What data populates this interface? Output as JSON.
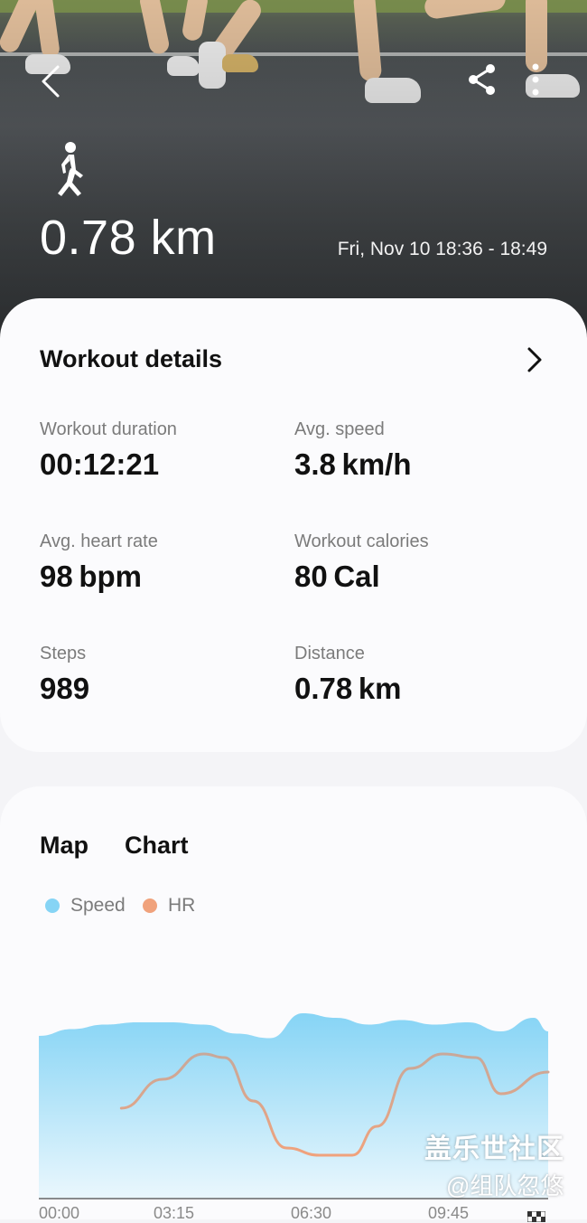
{
  "hero": {
    "distance": "0.78 km",
    "date_range": "Fri, Nov 10 18:36 - 18:49"
  },
  "icons": {
    "back": "back-arrow-icon",
    "share": "share-icon",
    "more": "more-vertical-icon",
    "activity": "walking-person-icon",
    "details": "chevron-right-icon"
  },
  "workout_details": {
    "title": "Workout details",
    "stats": [
      {
        "label": "Workout duration",
        "value": "00:12:21"
      },
      {
        "label": "Avg. speed",
        "value": "3.8 km/h"
      },
      {
        "label": "Avg. heart rate",
        "value": "98 bpm"
      },
      {
        "label": "Workout calories",
        "value": "80 Cal"
      },
      {
        "label": "Steps",
        "value": "989"
      },
      {
        "label": "Distance",
        "value": "0.78 km"
      }
    ]
  },
  "map_chart": {
    "tabs": [
      "Map",
      "Chart"
    ],
    "legend": [
      {
        "name": "Speed",
        "color": "#86d4f5"
      },
      {
        "name": "HR",
        "color": "#f0a27c"
      }
    ]
  },
  "chart_data": {
    "type": "area",
    "x_ticks": [
      "00:00",
      "03:15",
      "06:30",
      "09:45"
    ],
    "series": [
      {
        "name": "Speed",
        "kind": "area",
        "color": "#86d4f5",
        "x": [
          0,
          0.8,
          1.6,
          2.4,
          3.2,
          4.0,
          4.8,
          5.6,
          6.4,
          7.2,
          8.0,
          8.8,
          9.6,
          10.4,
          11.2,
          12.0,
          12.35
        ],
        "values": [
          3.6,
          3.75,
          3.85,
          3.9,
          3.9,
          3.85,
          3.65,
          3.55,
          4.1,
          4.0,
          3.85,
          3.95,
          3.85,
          3.9,
          3.7,
          4.0,
          3.7
        ]
      },
      {
        "name": "HR",
        "kind": "line",
        "color": "#f0a27c",
        "x": [
          2.0,
          3.0,
          4.0,
          4.5,
          5.2,
          6.0,
          6.8,
          7.6,
          8.2,
          9.0,
          9.8,
          10.6,
          11.2,
          12.35
        ],
        "values": [
          95,
          103,
          110,
          109,
          97,
          84,
          82,
          82,
          90,
          106,
          110,
          109,
          99,
          105
        ]
      }
    ]
  },
  "watermark": {
    "line1": "盖乐世社区",
    "line2": "@组队忽悠"
  }
}
